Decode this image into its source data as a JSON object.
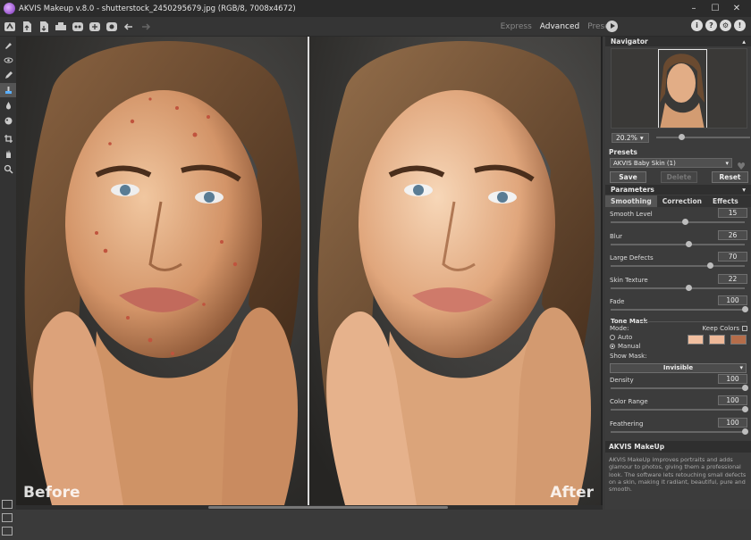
{
  "window": {
    "title": "AKVIS Makeup v.8.0 - shutterstock_2450295679.jpg (RGB/8, 7008x4672)",
    "controls": [
      "–",
      "☐",
      "✕"
    ]
  },
  "toolbar": {
    "icons": [
      "home-icon",
      "open-icon",
      "save-icon",
      "print-icon",
      "share-icon",
      "batch-icon",
      "plugin-icon",
      "undo-icon",
      "redo-icon"
    ],
    "modes": [
      "Express",
      "Advanced",
      "Presets"
    ],
    "active_mode": "Advanced",
    "right_icons": [
      "i",
      "?",
      "⚙",
      "!"
    ]
  },
  "tools": [
    "brush-icon",
    "eye-icon",
    "pencil-icon",
    "stamp-icon",
    "drop-icon",
    "chameleon-icon",
    "crop-icon",
    "hand-icon",
    "zoom-icon"
  ],
  "canvas": {
    "before_label": "Before",
    "after_label": "After"
  },
  "navigator": {
    "title": "Navigator",
    "zoom": "20.2%",
    "zoom_fraction": 0.2
  },
  "presets": {
    "title": "Presets",
    "selected": "AKVIS Baby Skin (1)",
    "save": "Save",
    "delete": "Delete",
    "reset": "Reset"
  },
  "parameters": {
    "title": "Parameters",
    "tabs": [
      "Smoothing",
      "Correction",
      "Effects"
    ],
    "active_tab": "Smoothing",
    "items": [
      {
        "label": "Smooth Level",
        "value": "15",
        "fraction": 0.55
      },
      {
        "label": "Blur",
        "value": "26",
        "fraction": 0.58
      },
      {
        "label": "Large Defects",
        "value": "70",
        "fraction": 0.74
      },
      {
        "label": "Skin Texture",
        "value": "22",
        "fraction": 0.58
      },
      {
        "label": "Fade",
        "value": "100",
        "fraction": 1.0
      }
    ]
  },
  "tone_mask": {
    "title": "Tone Mask",
    "mode_label": "Mode:",
    "keep_colors": "Keep Colors",
    "auto": "Auto",
    "manual": "Manual",
    "swatches": [
      "#f1bfa0",
      "#eeb898",
      "#b56d4a"
    ],
    "show_mask_label": "Show Mask:",
    "show_mask": "Invisible",
    "items": [
      {
        "label": "Density",
        "value": "100",
        "fraction": 1.0
      },
      {
        "label": "Color Range",
        "value": "100",
        "fraction": 1.0
      },
      {
        "label": "Feathering",
        "value": "100",
        "fraction": 1.0
      }
    ]
  },
  "info": {
    "title": "AKVIS MakeUp",
    "text": "AKVIS MakeUp improves portraits and adds glamour to photos, giving them a professional look. The software lets retouching small defects on a skin, making it radiant, beautiful, pure and smooth."
  }
}
